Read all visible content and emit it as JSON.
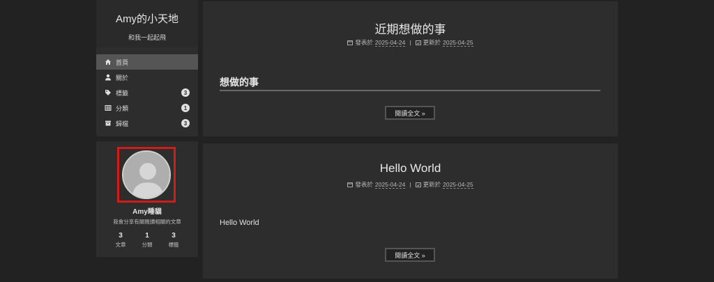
{
  "site": {
    "title": "Amy的小天地",
    "subtitle": "和我一起起飛"
  },
  "menu": [
    {
      "label": "首頁",
      "icon": "home-icon",
      "badge": null,
      "active": true
    },
    {
      "label": "關於",
      "icon": "user-icon",
      "badge": null,
      "active": false
    },
    {
      "label": "標籤",
      "icon": "tag-icon",
      "badge": "3",
      "active": false
    },
    {
      "label": "分類",
      "icon": "grid-icon",
      "badge": "1",
      "active": false
    },
    {
      "label": "歸檔",
      "icon": "archive-icon",
      "badge": "3",
      "active": false
    }
  ],
  "profile": {
    "name": "Amy睡貓",
    "description": "我會分享有關閱讀相關的文章",
    "stats": [
      {
        "count": "3",
        "label": "文章"
      },
      {
        "count": "1",
        "label": "分類"
      },
      {
        "count": "3",
        "label": "標籤"
      }
    ]
  },
  "posts": [
    {
      "title": "近期想做的事",
      "posted_label": "發表於",
      "posted_date": "2025-04-24",
      "updated_label": "更新於",
      "updated_date": "2025-04-25",
      "heading": "想做的事",
      "body": "",
      "read_more": "閱讀全文 »"
    },
    {
      "title": "Hello World",
      "posted_label": "發表於",
      "posted_date": "2025-04-24",
      "updated_label": "更新於",
      "updated_date": "2025-04-25",
      "heading": "",
      "body": "Hello World",
      "read_more": "閱讀全文 »"
    }
  ],
  "colors": {
    "background": "#222222",
    "panel": "#2d2d2d",
    "active_menu": "#555555",
    "highlight_border": "#d21b1b"
  }
}
